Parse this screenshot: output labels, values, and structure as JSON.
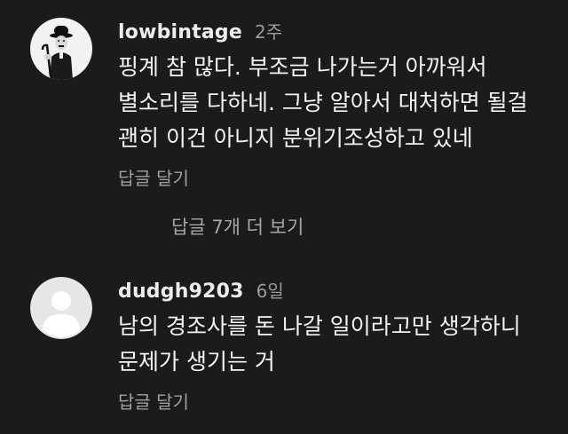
{
  "comments": [
    {
      "author": "lowbintage",
      "time": "2주",
      "lines": [
        "핑계 참 많다. 부조금 나가는거 아까워서",
        "별소리를 다하네. 그냥 알아서 대처하면 될걸",
        "괜히 이건 아니지 분위기조성하고 있네"
      ],
      "reply_label": "답글 달기",
      "avatar_icon": "chaplin-portrait-avatar"
    },
    {
      "author": "dudgh9203",
      "time": "6일",
      "lines": [
        "남의 경조사를 돈 나갈 일이라고만 생각하니",
        "문제가 생기는 거"
      ],
      "reply_label": "답글 달기",
      "avatar_icon": "default-user-avatar"
    }
  ],
  "more_replies_label": "답글 7개 더 보기",
  "colors": {
    "background": "#1b1b1b",
    "text": "#f3f3f3",
    "muted": "#9a9a9a"
  }
}
